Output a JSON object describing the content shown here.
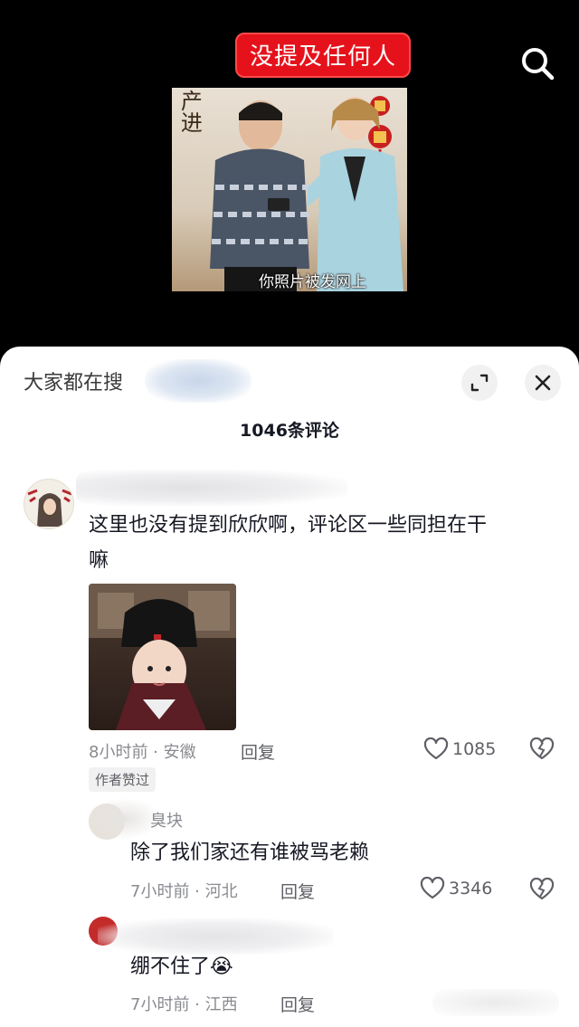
{
  "video": {
    "tag_text": "没提及任何人",
    "subtitle": "你照片被发网上",
    "wall_text": "产进"
  },
  "sheet": {
    "hot_search_label": "大家都在搜",
    "comment_count": "1046条评论"
  },
  "comments": [
    {
      "text_line1": "这里也没有提到欣欣啊，评论区一些同担在干",
      "text_line2": "嘛",
      "meta": "8小时前 · 安徽",
      "reply_label": "回复",
      "likes": "1085",
      "badge": "作者赞过"
    }
  ],
  "replies": [
    {
      "name_tail": "臭块",
      "text": "除了我们家还有谁被骂老赖",
      "meta": "7小时前 · 河北",
      "reply_label": "回复",
      "likes": "3346"
    },
    {
      "text": "绷不住了😭",
      "meta": "7小时前 · 江西",
      "reply_label": "回复"
    }
  ],
  "colors": {
    "tag_bg": "#e5121b",
    "sheet_bg": "#ffffff",
    "meta_gray": "#8a8b91"
  },
  "icons": [
    "search-icon",
    "expand-icon",
    "close-icon",
    "heart-icon",
    "broken-heart-icon"
  ]
}
